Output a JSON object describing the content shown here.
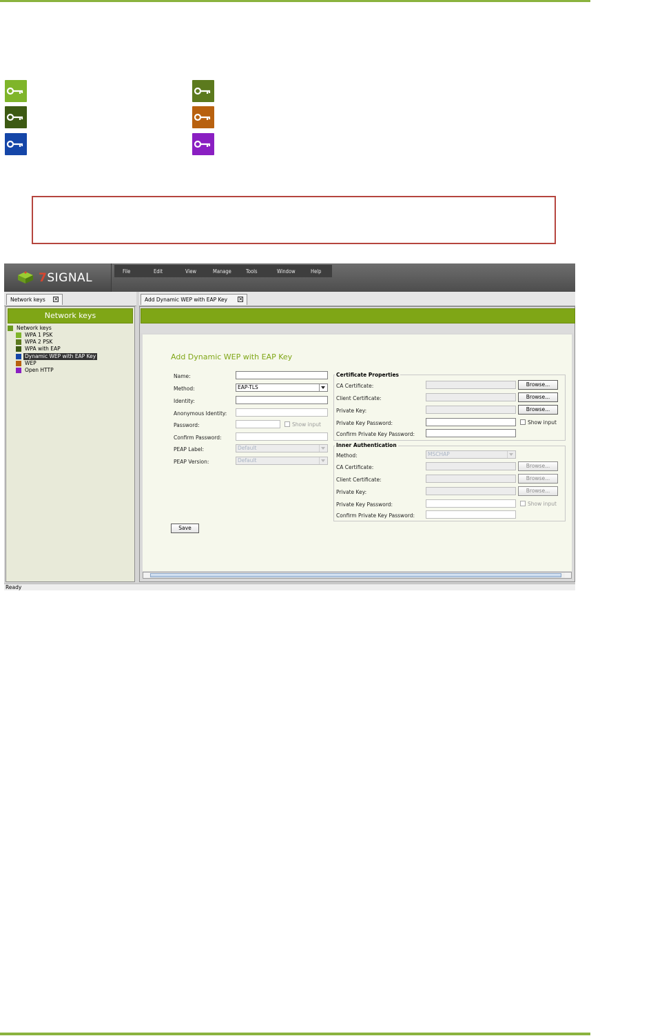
{
  "key_legend": [
    {
      "icon": "green-key-icon",
      "color": "#7fb52a"
    },
    {
      "icon": "olive-key-icon",
      "color": "#5c7a1e"
    },
    {
      "icon": "dark-green-key-icon",
      "color": "#3d5a13"
    },
    {
      "icon": "orange-key-icon",
      "color": "#b8610f"
    },
    {
      "icon": "blue-key-icon",
      "color": "#1546a8"
    },
    {
      "icon": "purple-key-icon",
      "color": "#8a1fc2"
    }
  ],
  "app": {
    "logo": "7SIGNAL",
    "menu": [
      "File",
      "Edit",
      "View",
      "Manage",
      "Tools",
      "Window",
      "Help"
    ],
    "left_tab": "Network keys",
    "right_tab": "Add Dynamic WEP with EAP Key",
    "left_panel_header": "Network keys",
    "tree": {
      "root": "Network keys",
      "items": [
        {
          "label": "WPA 1 PSK",
          "icon": "green-key-icon"
        },
        {
          "label": "WPA 2 PSK",
          "icon": "olive-key-icon"
        },
        {
          "label": "WPA with EAP",
          "icon": "dark-green-key-icon"
        },
        {
          "label": "Dynamic WEP with EAP Key",
          "icon": "blue-key-icon",
          "selected": true
        },
        {
          "label": "WEP",
          "icon": "orange-key-icon"
        },
        {
          "label": "Open HTTP",
          "icon": "purple-key-icon"
        }
      ]
    },
    "status": "Ready"
  },
  "form": {
    "title": "Add Dynamic WEP with EAP Key",
    "name_label": "Name:",
    "method_label": "Method:",
    "method_value": "EAP-TLS",
    "identity_label": "Identity:",
    "anon_identity_label": "Anonymous Identity:",
    "password_label": "Password:",
    "show_input": "Show input",
    "confirm_password_label": "Confirm Password:",
    "peap_label_label": "PEAP Label:",
    "peap_label_value": "Default",
    "peap_version_label": "PEAP Version:",
    "peap_version_value": "Default",
    "save_button": "Save",
    "cert": {
      "title": "Certificate Properties",
      "ca_label": "CA Certificate:",
      "client_label": "Client Certificate:",
      "private_key_label": "Private Key:",
      "pk_password_label": "Private Key Password:",
      "confirm_pk_password_label": "Confirm Private Key Password:",
      "browse": "Browse...",
      "show_input": "Show input"
    },
    "inner": {
      "title": "Inner Authentication",
      "method_label": "Method:",
      "method_value": "MSCHAP",
      "ca_label": "CA Certificate:",
      "client_label": "Client Certificate:",
      "private_key_label": "Private Key:",
      "pk_password_label": "Private Key Password:",
      "confirm_pk_password_label": "Confirm Private Key Password:",
      "browse": "Browse...",
      "show_input": "Show input"
    }
  }
}
